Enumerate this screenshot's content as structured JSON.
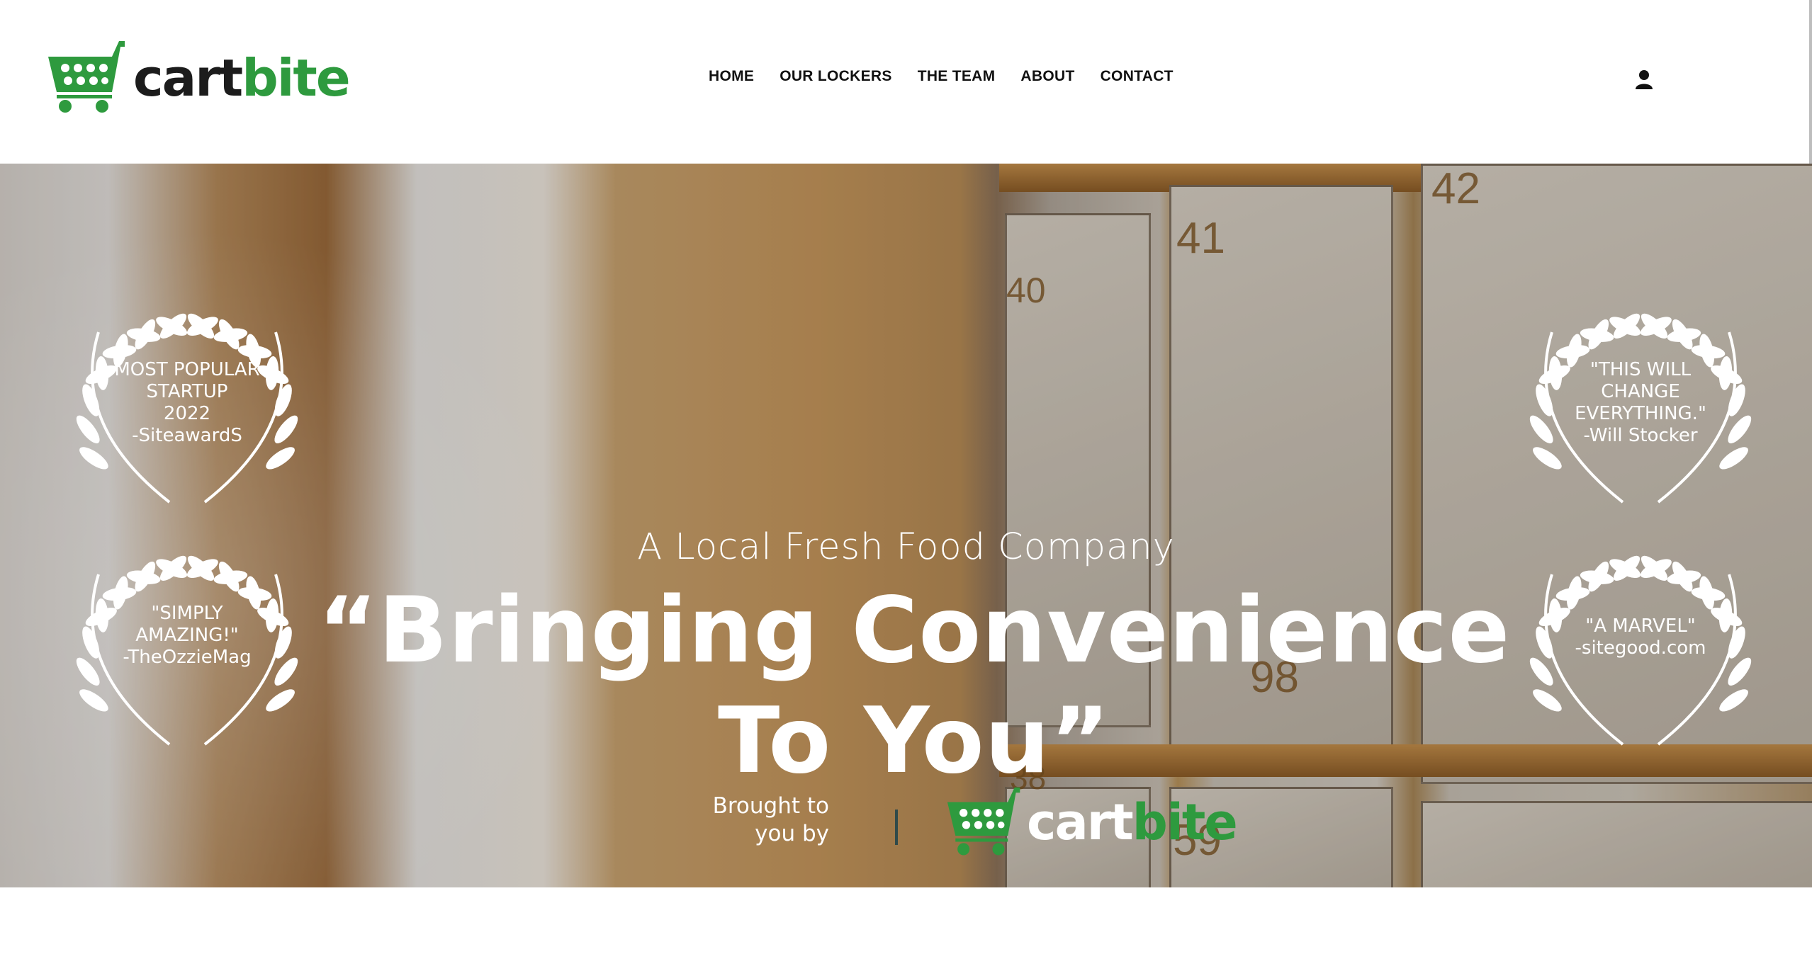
{
  "brand": {
    "part1": "cart",
    "part2": "bite"
  },
  "nav": {
    "items": [
      "HOME",
      "OUR LOCKERS",
      "THE TEAM",
      "ABOUT",
      "CONTACT"
    ]
  },
  "header": {
    "user_icon": "user-icon"
  },
  "hero": {
    "tagline": "A Local Fresh Food Company",
    "headline_line1": "“Bringing Convenience",
    "headline_line2": "To You”",
    "brought_by_line1": "Brought to",
    "brought_by_line2": "you by",
    "locker_numbers": [
      "40",
      "41",
      "42",
      "98",
      "59",
      "38"
    ]
  },
  "awards": [
    {
      "lines": [
        "MOST POPULAR",
        "STARTUP",
        "2022",
        "-SiteawardS"
      ]
    },
    {
      "lines": [
        "\"SIMPLY",
        "AMAZING!\"",
        "-TheOzzieMag"
      ]
    },
    {
      "lines": [
        "\"THIS WILL",
        "CHANGE",
        "EVERYTHING.\"",
        "-Will Stocker"
      ]
    },
    {
      "lines": [
        "\"A MARVEL\"",
        "-sitegood.com"
      ]
    }
  ],
  "colors": {
    "brand_green": "#2e9a3e",
    "text_dark": "#1c1c1c"
  }
}
